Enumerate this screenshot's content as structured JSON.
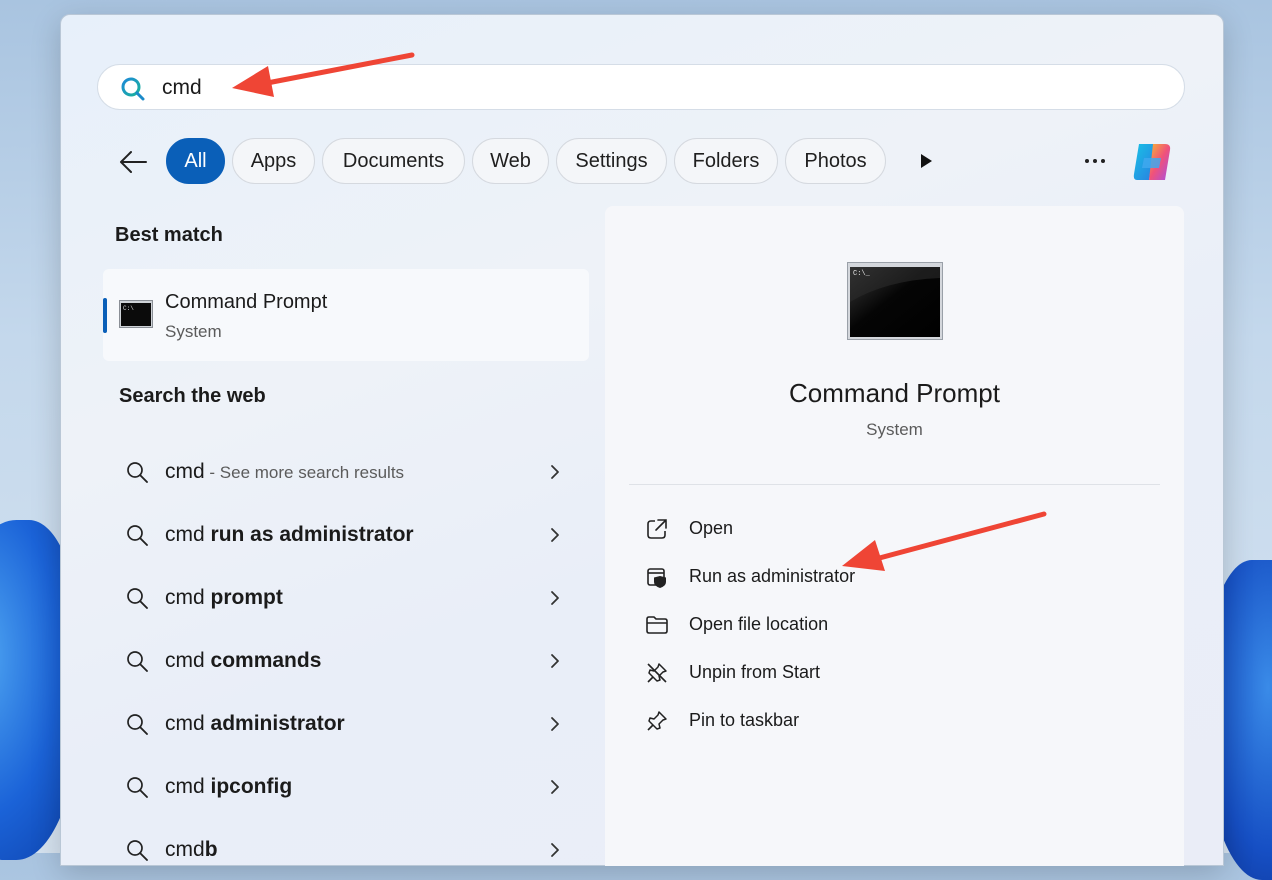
{
  "search": {
    "value": "cmd"
  },
  "filters": [
    "All",
    "Apps",
    "Documents",
    "Web",
    "Settings",
    "Folders",
    "Photos"
  ],
  "best_match": {
    "heading": "Best match",
    "name": "Command Prompt",
    "type": "System"
  },
  "web": {
    "heading": "Search the web",
    "items": [
      {
        "prefix": "cmd",
        "bold": "",
        "hint": " - See more search results"
      },
      {
        "prefix": "cmd ",
        "bold": "run as administrator",
        "hint": ""
      },
      {
        "prefix": "cmd ",
        "bold": "prompt",
        "hint": ""
      },
      {
        "prefix": "cmd ",
        "bold": "commands",
        "hint": ""
      },
      {
        "prefix": "cmd ",
        "bold": "administrator",
        "hint": ""
      },
      {
        "prefix": "cmd ",
        "bold": "ipconfig",
        "hint": ""
      },
      {
        "prefix": "cmd",
        "bold": "b",
        "hint": ""
      }
    ]
  },
  "preview": {
    "title": "Command Prompt",
    "subtitle": "System",
    "actions": [
      "Open",
      "Run as administrator",
      "Open file location",
      "Unpin from Start",
      "Pin to taskbar"
    ]
  },
  "colors": {
    "accent": "#0a5fb8",
    "annotation_arrow": "#ef4535"
  }
}
